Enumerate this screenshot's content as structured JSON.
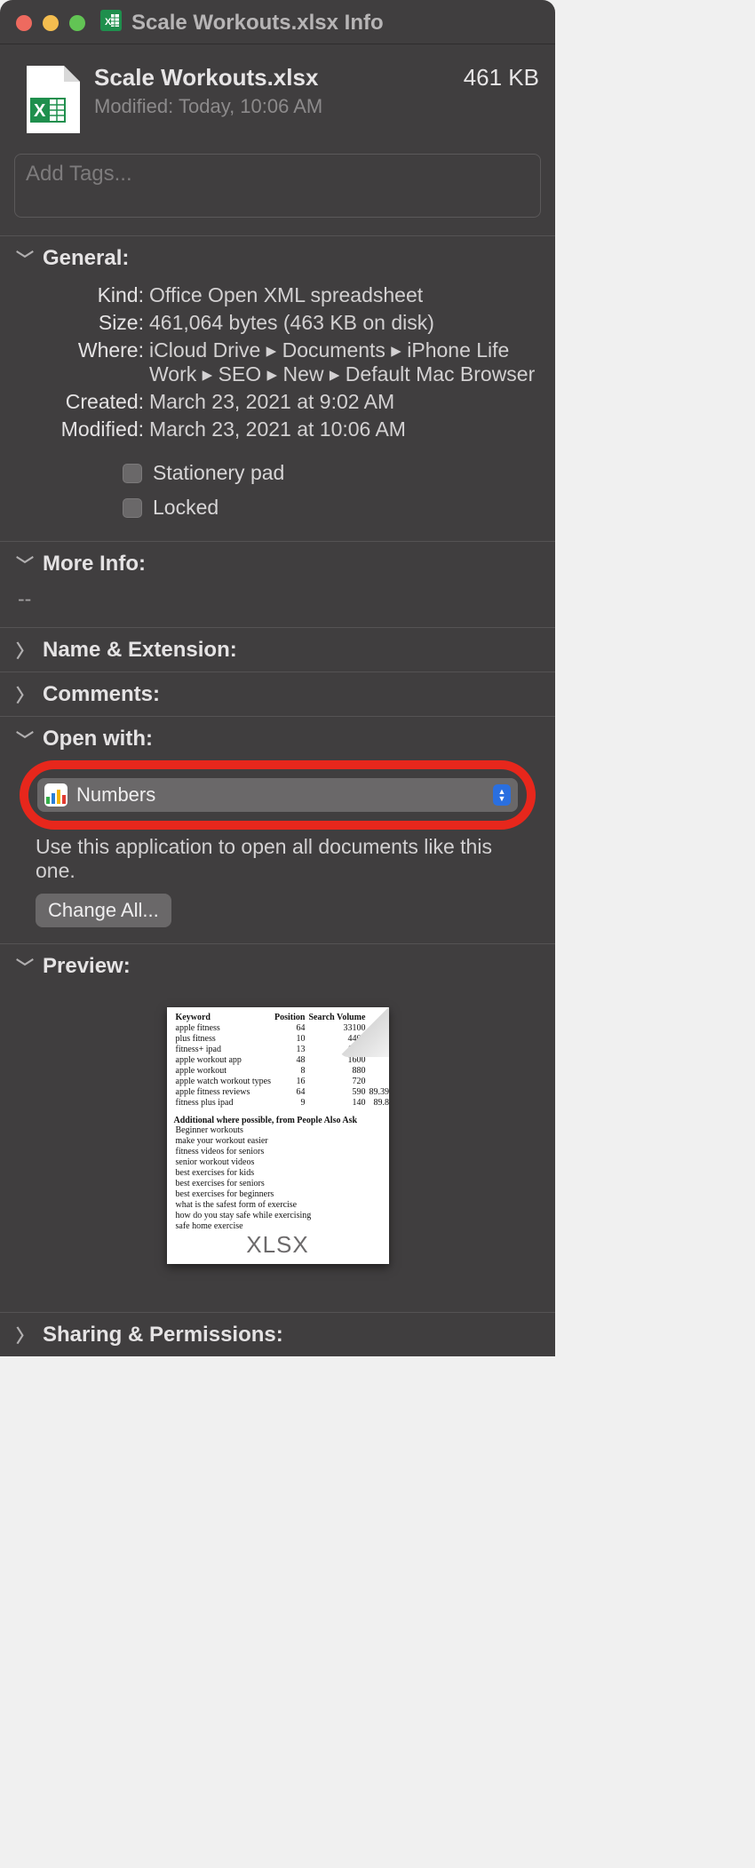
{
  "titlebar": {
    "title": "Scale Workouts.xlsx Info"
  },
  "header": {
    "filename": "Scale Workouts.xlsx",
    "size": "461 KB",
    "modified_label": "Modified:",
    "modified_value": "Today, 10:06 AM"
  },
  "tags": {
    "placeholder": "Add Tags..."
  },
  "general": {
    "title": "General:",
    "kind_label": "Kind:",
    "kind_value": "Office Open XML spreadsheet",
    "size_label": "Size:",
    "size_value": "461,064 bytes (463 KB on disk)",
    "where_label": "Where:",
    "where_value": "iCloud Drive ▸ Documents ▸ iPhone Life Work ▸ SEO ▸ New ▸ Default Mac Browser",
    "created_label": "Created:",
    "created_value": "March 23, 2021 at 9:02 AM",
    "modified_label": "Modified:",
    "modified_value": "March 23, 2021 at 10:06 AM",
    "stationery_label": "Stationery pad",
    "locked_label": "Locked"
  },
  "more_info": {
    "title": "More Info:",
    "body": "--"
  },
  "name_ext": {
    "title": "Name & Extension:"
  },
  "comments": {
    "title": "Comments:"
  },
  "open_with": {
    "title": "Open with:",
    "app": "Numbers",
    "help_text": "Use this application to open all documents like this one.",
    "change_all": "Change All..."
  },
  "preview": {
    "title": "Preview:",
    "ext_label": "XLSX",
    "cols": [
      "Keyword",
      "Position",
      "Search Volume"
    ],
    "rows": [
      [
        "apple fitness",
        "64",
        "33100"
      ],
      [
        "plus fitness",
        "10",
        "4400"
      ],
      [
        "fitness+ ipad",
        "13",
        "1900"
      ],
      [
        "apple workout app",
        "48",
        "1600"
      ],
      [
        "apple workout",
        "8",
        "880"
      ],
      [
        "apple watch workout types",
        "16",
        "720"
      ],
      [
        "apple fitness reviews",
        "64",
        "590"
      ],
      [
        "fitness plus ipad",
        "9",
        "140"
      ]
    ],
    "extra_col": [
      "",
      "",
      "",
      "",
      "",
      "",
      "89.39",
      "89.8"
    ],
    "section2_title": "Additional where possible, from People Also Ask",
    "section2_rows": [
      "Beginner workouts",
      "make your workout easier",
      "fitness videos for seniors",
      "senior workout videos",
      "best exercises for kids",
      "best exercises for seniors",
      "best exercises for beginners",
      "what is the safest form of exercise",
      "how do you stay safe while exercising",
      "safe home exercise"
    ]
  },
  "sharing": {
    "title": "Sharing & Permissions:"
  }
}
